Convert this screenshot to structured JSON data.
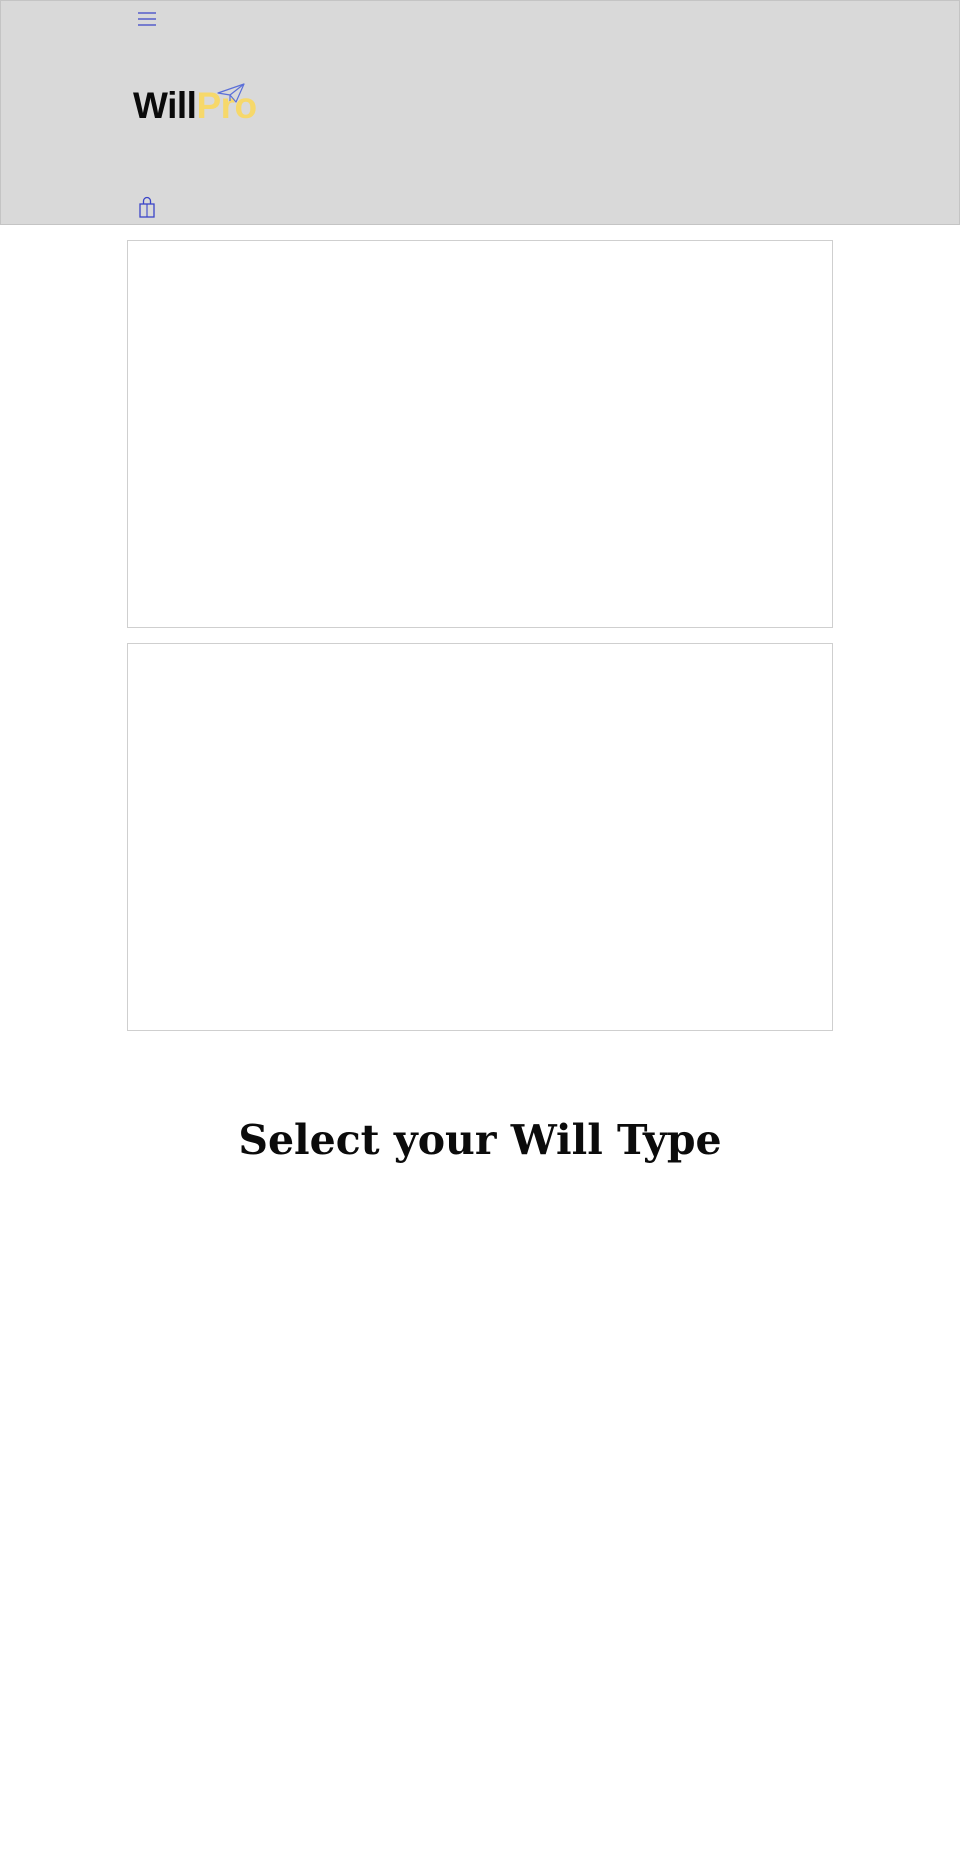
{
  "header": {
    "logo": {
      "part_1": "Will",
      "part_2": "Pro"
    },
    "icons": {
      "menu": "hamburger-menu-icon",
      "logo_mark": "paper-plane-icon",
      "cart": "shopping-bag-icon"
    },
    "colors": {
      "background": "#d9d9d9",
      "icon_accent": "#3b45c8",
      "logo_accent": "#f6d86a"
    }
  },
  "main": {
    "title": "Select your Will Type"
  }
}
